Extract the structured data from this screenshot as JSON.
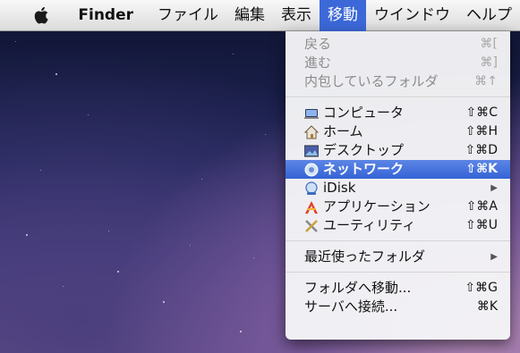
{
  "menubar": {
    "app_name": "Finder",
    "items": [
      "ファイル",
      "編集",
      "表示",
      "移動",
      "ウインドウ",
      "ヘルプ"
    ],
    "active_index": 3
  },
  "menu": {
    "nav": [
      {
        "label": "戻る",
        "shortcut": "⌘[",
        "enabled": false
      },
      {
        "label": "進む",
        "shortcut": "⌘]",
        "enabled": false
      },
      {
        "label": "内包しているフォルダ",
        "shortcut": "⌘↑",
        "enabled": false
      }
    ],
    "places": [
      {
        "label": "コンピュータ",
        "shortcut": "⇧⌘C",
        "icon": "computer-icon"
      },
      {
        "label": "ホーム",
        "shortcut": "⇧⌘H",
        "icon": "home-icon"
      },
      {
        "label": "デスクトップ",
        "shortcut": "⇧⌘D",
        "icon": "desktop-icon"
      },
      {
        "label": "ネットワーク",
        "shortcut": "⇧⌘K",
        "icon": "network-icon",
        "highlighted": true
      },
      {
        "label": "iDisk",
        "shortcut": "▶",
        "icon": "idisk-icon",
        "submenu": true
      },
      {
        "label": "アプリケーション",
        "shortcut": "⇧⌘A",
        "icon": "applications-icon"
      },
      {
        "label": "ユーティリティ",
        "shortcut": "⇧⌘U",
        "icon": "utilities-icon"
      }
    ],
    "recent": {
      "label": "最近使ったフォルダ",
      "shortcut": "▶"
    },
    "goto": [
      {
        "label": "フォルダへ移動...",
        "shortcut": "⇧⌘G"
      },
      {
        "label": "サーバへ接続...",
        "shortcut": "⌘K"
      }
    ]
  },
  "colors": {
    "highlight": "#3c68d8",
    "menubar": "#e8e8e8"
  }
}
